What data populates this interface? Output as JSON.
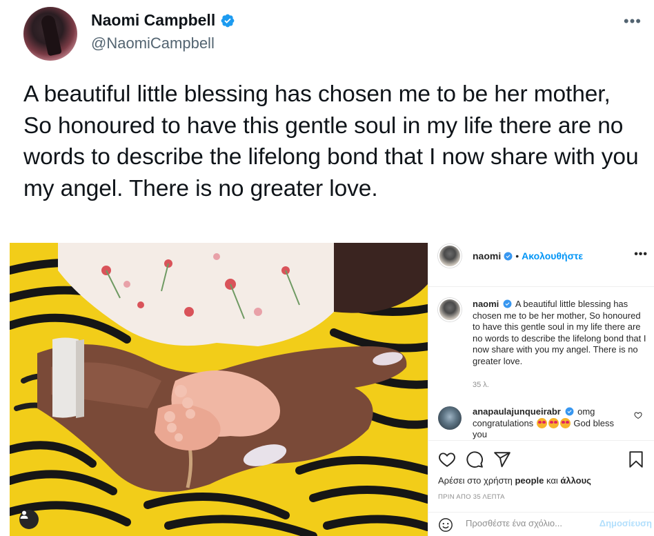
{
  "tweet": {
    "name": "Naomi Campbell",
    "handle": "@NaomiCampbell",
    "more_icon": "ellipsis-icon",
    "text": "A beautiful little blessing has chosen me to be her mother, So honoured to have this gentle soul in my life there are no words to describe the lifelong bond that I now share with you my angel. There is no greater love.",
    "verified_color": "#1d9bf0"
  },
  "instagram": {
    "username": "naomi",
    "separator": "•",
    "follow_label": "Ακολουθήστε",
    "more_icon": "ellipsis-icon",
    "caption_user": "naomi",
    "caption_text": "A beautiful little blessing has chosen me to be her mother, So honoured to have this gentle soul in my life there are no words to describe the lifelong bond that I now share with you my angel. There is no greater love.",
    "caption_time": "35 λ.",
    "comment": {
      "user": "anapaulajunqueirabr",
      "text_before": "omg congratulations",
      "text_after": "God bless you"
    },
    "likes_prefix": "Αρέσει στο χρήστη",
    "likes_user": "people",
    "likes_mid": "και",
    "likes_others": "άλλους",
    "posted_ago": "ΠΡΙΝ ΑΠΟ 35 ΛΕΠΤΑ",
    "comment_placeholder": "Προσθέστε ένα σχόλιο...",
    "post_label": "Δημοσίευση",
    "accent_color": "#0095f6"
  }
}
